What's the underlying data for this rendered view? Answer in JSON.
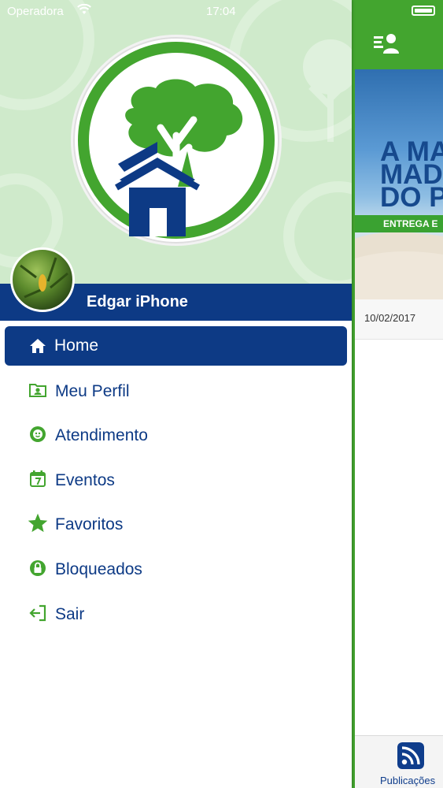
{
  "status_bar": {
    "carrier": "Operadora",
    "time": "17:04"
  },
  "user": {
    "name": "Edgar iPhone"
  },
  "menu": {
    "items": [
      {
        "label": "Home",
        "icon": "home-icon",
        "active": true
      },
      {
        "label": "Meu Perfil",
        "icon": "profile-card-icon",
        "active": false
      },
      {
        "label": "Atendimento",
        "icon": "support-agent-icon",
        "active": false
      },
      {
        "label": "Eventos",
        "icon": "calendar-icon",
        "active": false
      },
      {
        "label": "Favoritos",
        "icon": "star-icon",
        "active": false
      },
      {
        "label": "Bloqueados",
        "icon": "lock-icon",
        "active": false
      },
      {
        "label": "Sair",
        "icon": "logout-icon",
        "active": false
      }
    ]
  },
  "main": {
    "banner": {
      "text": "A MA\nMAD\nDO P",
      "strip": "ENTREGA E"
    },
    "post_date": "10/02/2017",
    "tab": {
      "label": "Publicações",
      "icon": "rss-icon"
    }
  },
  "colors": {
    "brand_green": "#43a52f",
    "brand_navy": "#0d3a85",
    "header_bg": "#cfeacb"
  }
}
